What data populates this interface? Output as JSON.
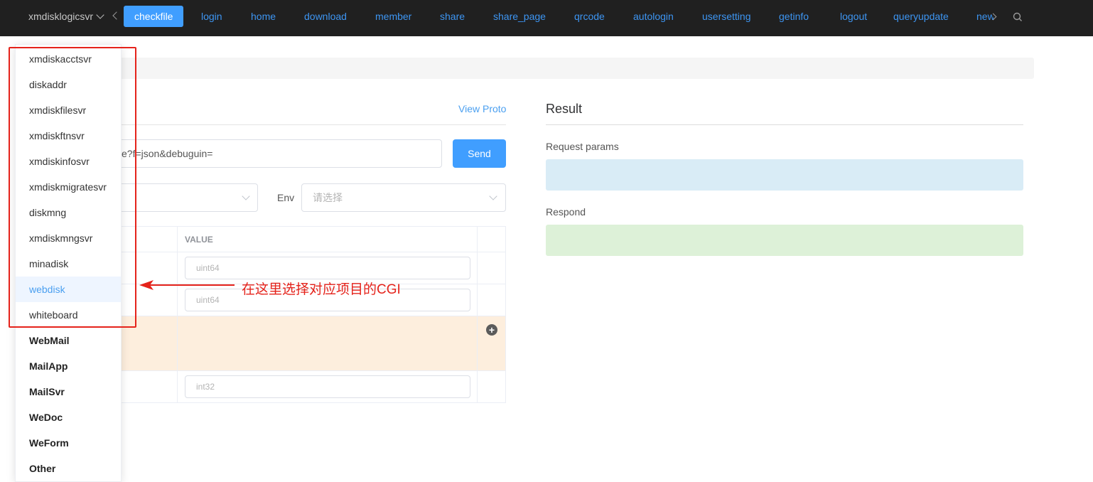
{
  "nav": {
    "server_select": "xmdisklogicsvr",
    "tabs": [
      {
        "label": "checkfile",
        "active": true
      },
      {
        "label": "login"
      },
      {
        "label": "home"
      },
      {
        "label": "download"
      },
      {
        "label": "member"
      },
      {
        "label": "share"
      },
      {
        "label": "share_page"
      },
      {
        "label": "qrcode"
      },
      {
        "label": "autologin"
      },
      {
        "label": "usersetting"
      },
      {
        "label": "getinfo"
      },
      {
        "label": "logout"
      },
      {
        "label": "queryupdate"
      },
      {
        "label": "new"
      }
    ]
  },
  "request": {
    "view_proto": "View Proto",
    "url_value": "e?f=json&debuguin=",
    "send_label": "Send",
    "env_label": "Env",
    "env_placeholder": "请选择",
    "table": {
      "value_header": "VALUE",
      "rows": [
        {
          "placeholder": "uint64"
        },
        {
          "placeholder": "uint64"
        },
        {
          "placeholder": "int32"
        }
      ]
    }
  },
  "result": {
    "title": "Result",
    "request_params_label": "Request params",
    "respond_label": "Respond"
  },
  "dropdown": {
    "items": [
      {
        "label": "xmdiskacctsvr"
      },
      {
        "label": "diskaddr"
      },
      {
        "label": "xmdiskfilesvr"
      },
      {
        "label": "xmdiskftnsvr"
      },
      {
        "label": "xmdiskinfosvr"
      },
      {
        "label": "xmdiskmigratesvr"
      },
      {
        "label": "diskmng"
      },
      {
        "label": "xmdiskmngsvr"
      },
      {
        "label": "minadisk"
      },
      {
        "label": "webdisk",
        "selected": true
      },
      {
        "label": "whiteboard"
      }
    ],
    "groups": [
      {
        "label": "WebMail"
      },
      {
        "label": "MailApp"
      },
      {
        "label": "MailSvr"
      },
      {
        "label": "WeDoc"
      },
      {
        "label": "WeForm"
      },
      {
        "label": "Other"
      }
    ]
  },
  "annotation": {
    "text": "在这里选择对应项目的CGI"
  },
  "colors": {
    "accent": "#409eff",
    "annotation_red": "#e5231b",
    "nav_bg": "#202020"
  }
}
